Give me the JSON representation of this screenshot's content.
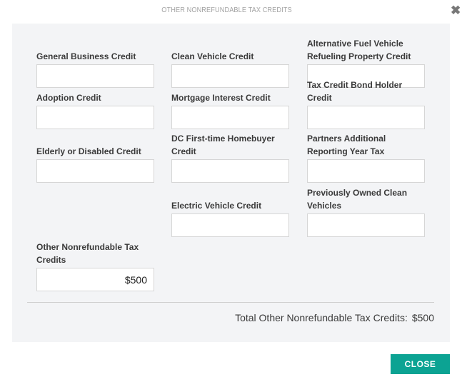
{
  "modal": {
    "title": "OTHER NONREFUNDABLE TAX CREDITS",
    "close_icon": "close-x-icon"
  },
  "fields": [
    {
      "label": "General Business Credit",
      "value": "",
      "placeholder": ""
    },
    {
      "label": "Clean Vehicle Credit",
      "value": "",
      "placeholder": ""
    },
    {
      "label": "Alternative Fuel Vehicle Refueling Property Credit",
      "value": "",
      "placeholder": ""
    },
    {
      "label": "Adoption Credit",
      "value": "",
      "placeholder": ""
    },
    {
      "label": "Mortgage Interest Credit",
      "value": "",
      "placeholder": ""
    },
    {
      "label": "Tax Credit Bond Holder Credit",
      "value": "",
      "placeholder": ""
    },
    {
      "label": "Elderly or Disabled Credit",
      "value": "",
      "placeholder": ""
    },
    {
      "label": "DC First-time Homebuyer Credit",
      "value": "",
      "placeholder": ""
    },
    {
      "label": "Partners Additional Reporting Year Tax",
      "value": "",
      "placeholder": ""
    },
    {
      "label": "Electric Vehicle Credit",
      "value": "",
      "placeholder": ""
    },
    {
      "label": "Previously Owned Clean Vehicles",
      "value": "",
      "placeholder": ""
    },
    {
      "label": "Other Nonrefundable Tax Credits",
      "value": "$500",
      "placeholder": ""
    }
  ],
  "total": {
    "label": "Total Other Nonrefundable Tax Credits:",
    "amount": "$500"
  },
  "footer": {
    "close_label": "CLOSE",
    "close_color": "#0ca393"
  }
}
